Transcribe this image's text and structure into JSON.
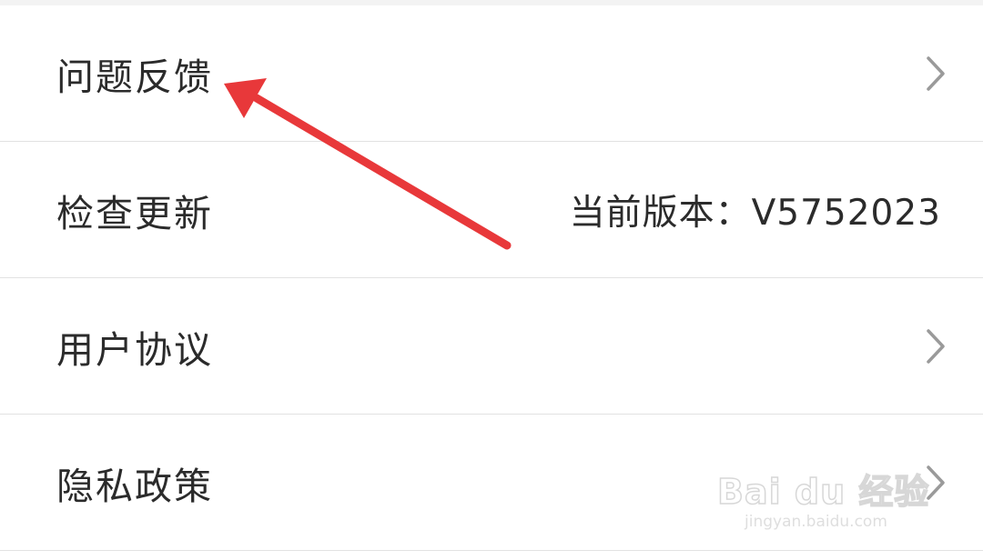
{
  "settings": {
    "items": [
      {
        "label": "问题反馈",
        "has_chevron": true,
        "value": ""
      },
      {
        "label": "检查更新",
        "has_chevron": false,
        "value": "当前版本：V5752023"
      },
      {
        "label": "用户协议",
        "has_chevron": true,
        "value": ""
      },
      {
        "label": "隐私政策",
        "has_chevron": true,
        "value": ""
      }
    ]
  },
  "annotation": {
    "arrow_color": "#e8383a",
    "points_to": "问题反馈"
  },
  "watermark": {
    "brand": "Bai du 经验",
    "url": "jingyan.baidu.com"
  },
  "colors": {
    "text": "#2b2b2b",
    "divider": "#e2e2e2",
    "chevron": "#9a9a9a",
    "background": "#ffffff"
  }
}
